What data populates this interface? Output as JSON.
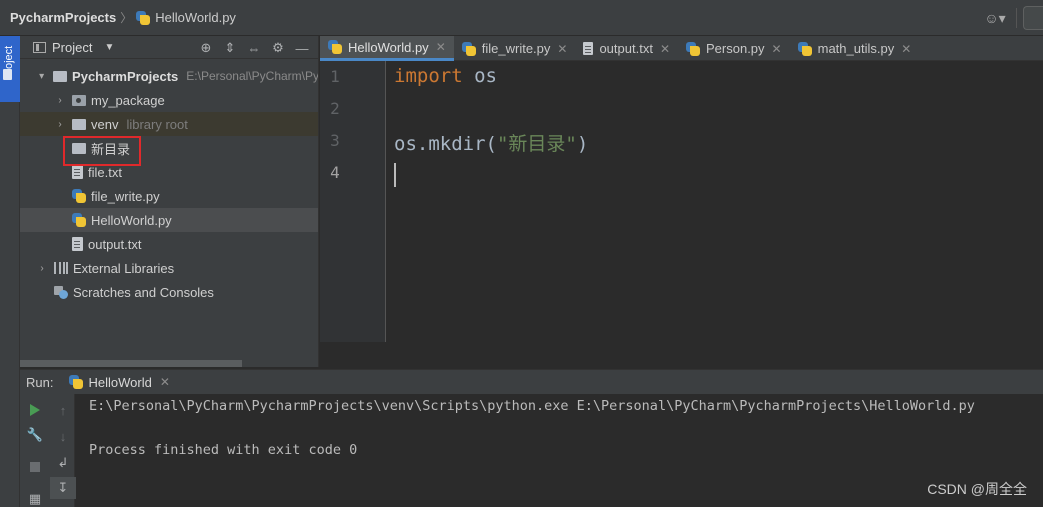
{
  "breadcrumb": {
    "project": "PycharmProjects",
    "separator": "〉",
    "file": "HelloWorld.py"
  },
  "project_panel": {
    "title": "Project",
    "tree": [
      {
        "label": "PycharmProjects",
        "hint": "E:\\Personal\\PyCharm\\Py",
        "icon": "folder-icon",
        "arrow": "▾",
        "depth": 0
      },
      {
        "label": "my_package",
        "hint": "",
        "icon": "package-icon",
        "arrow": "›",
        "depth": 1
      },
      {
        "label": "venv",
        "hint": "library root",
        "icon": "folder-icon",
        "arrow": "›",
        "depth": 1
      },
      {
        "label": "新目录",
        "hint": "",
        "icon": "folder-icon",
        "arrow": "",
        "depth": 1
      },
      {
        "label": "file.txt",
        "hint": "",
        "icon": "text-file-icon",
        "arrow": "",
        "depth": 1
      },
      {
        "label": "file_write.py",
        "hint": "",
        "icon": "python-file-icon",
        "arrow": "",
        "depth": 1
      },
      {
        "label": "HelloWorld.py",
        "hint": "",
        "icon": "python-file-icon",
        "arrow": "",
        "depth": 1,
        "selected": true
      },
      {
        "label": "output.txt",
        "hint": "",
        "icon": "text-file-icon",
        "arrow": "",
        "depth": 1
      },
      {
        "label": "External Libraries",
        "hint": "",
        "icon": "library-icon",
        "arrow": "›",
        "depth": 0
      },
      {
        "label": "Scratches and Consoles",
        "hint": "",
        "icon": "scratches-icon",
        "arrow": "",
        "depth": 0
      }
    ]
  },
  "stripe": {
    "project_label": "Project"
  },
  "tabs": [
    {
      "label": "HelloWorld.py",
      "active": true,
      "icon": "python-file-icon"
    },
    {
      "label": "file_write.py",
      "active": false,
      "icon": "python-file-icon"
    },
    {
      "label": "output.txt",
      "active": false,
      "icon": "text-file-icon"
    },
    {
      "label": "Person.py",
      "active": false,
      "icon": "python-file-icon"
    },
    {
      "label": "math_utils.py",
      "active": false,
      "icon": "python-file-icon"
    }
  ],
  "editor": {
    "line_numbers": [
      "1",
      "2",
      "3",
      "4"
    ],
    "lines": [
      {
        "kw": "import",
        "rest": " os",
        "str": "",
        "tail": ""
      },
      {
        "kw": "",
        "rest": "",
        "str": "",
        "tail": ""
      },
      {
        "kw": "",
        "rest": "os.mkdir(",
        "str": "\"新目录\"",
        "tail": ")"
      },
      {
        "kw": "",
        "rest": "",
        "str": "",
        "tail": ""
      }
    ],
    "current_line": 4
  },
  "run": {
    "label": "Run:",
    "tab": "HelloWorld",
    "output": [
      "E:\\Personal\\PyCharm\\PycharmProjects\\venv\\Scripts\\python.exe E:\\Personal\\PyCharm\\PycharmProjects\\HelloWorld.py",
      "",
      "Process finished with exit code 0"
    ]
  },
  "watermark": "CSDN @周全全",
  "colors": {
    "keyword": "#cc7832",
    "string": "#6a8759",
    "accent": "#4a88c7",
    "highlight": "#e0292b"
  }
}
